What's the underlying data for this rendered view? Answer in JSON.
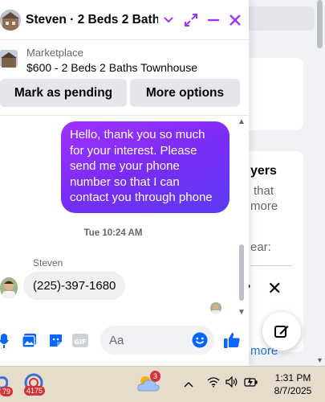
{
  "chat": {
    "title": "Steven · 2 Beds 2 Bath...",
    "listing_label": "Marketplace",
    "listing_title": "$600 - 2 Beds 2 Baths Townhouse",
    "actions": [
      "Mark as pending",
      "More options"
    ],
    "messages": [
      {
        "from": "me",
        "text": "Hello, thank you so much for your interest. Please send me your phone number so that I can contact you through phone"
      },
      {
        "from": "Steven",
        "text": "(225)-397-1680"
      }
    ],
    "timestamp": "Tue 10:24 AM",
    "sender_name": "Steven",
    "composer_placeholder": "Aa"
  },
  "background": {
    "heading_fragment": "yers",
    "lines": [
      "that",
      "more",
      "ear:"
    ],
    "more_link": "more"
  },
  "taskbar": {
    "app_badge_left": "79",
    "app_badge_2": "4175",
    "weather_badge": "3",
    "time": "1:31 PM",
    "date": "8/7/2025"
  },
  "colors": {
    "accent": "#0866ff",
    "bubble_out_start": "#a033ff",
    "bubble_out_end": "#5b3cf5"
  }
}
